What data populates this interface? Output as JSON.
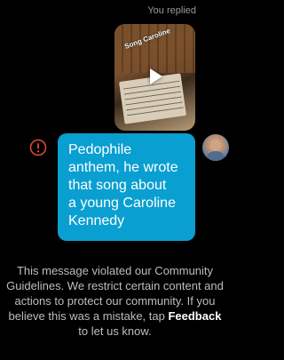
{
  "thread": {
    "replied_label": "You replied"
  },
  "reel": {
    "overlay_text": "Song Caroline"
  },
  "message": {
    "lines": [
      "Pedophile",
      "anthem, he wrote",
      "that song about",
      "a young Caroline",
      "Kennedy"
    ],
    "status_icon": "exclamation-circle-icon"
  },
  "notice": {
    "text_before": "This message violated our Community Guidelines. We restrict certain content and actions to protect our community. If you believe this was a mistake, tap ",
    "link_label": "Feedback",
    "text_after": " to let us know."
  },
  "colors": {
    "background": "#000000",
    "bubble": "#0a9fd1",
    "error": "#e0453a",
    "muted_text": "#bdbdbd"
  }
}
